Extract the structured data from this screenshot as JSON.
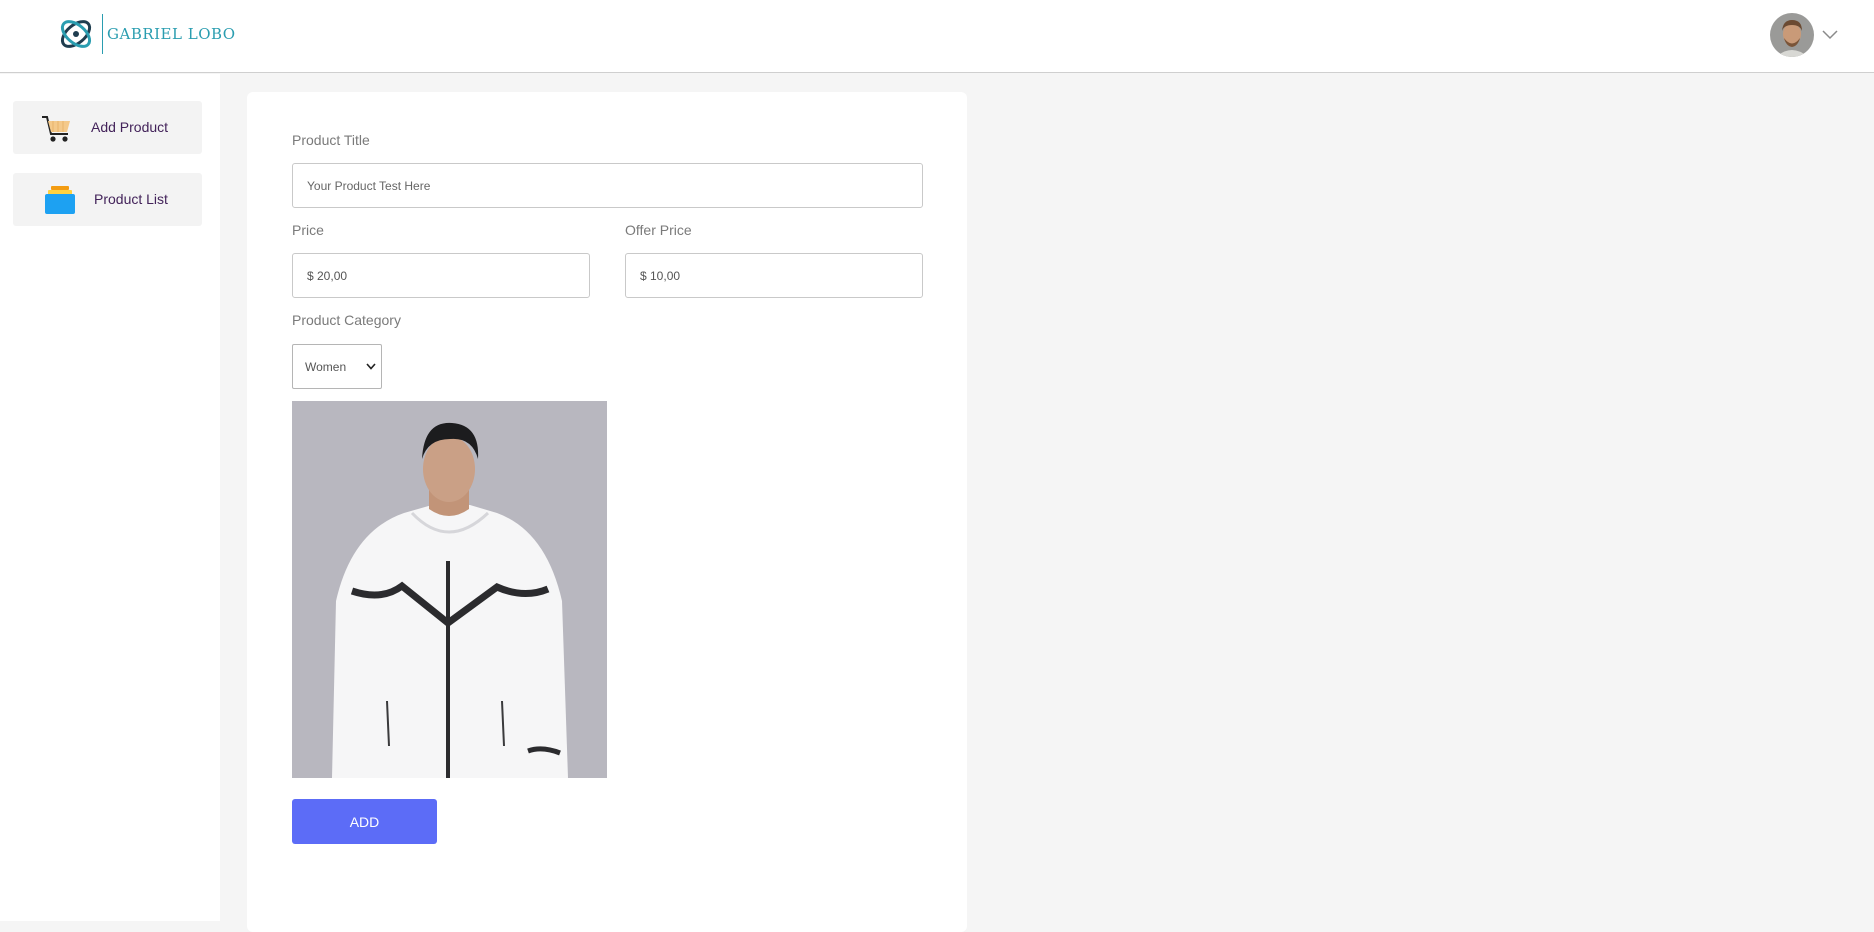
{
  "header": {
    "brand_name": "GABRIEL LOBO",
    "logo_icon": "orbit-logo-icon",
    "brand_color": "#2a9db0",
    "profile_menu_icon": "chevron-down-icon"
  },
  "sidebar": {
    "items": [
      {
        "label": "Add Product",
        "icon": "cart-icon"
      },
      {
        "label": "Product List",
        "icon": "stack-icon"
      }
    ]
  },
  "form": {
    "title_label": "Product Title",
    "title_placeholder": "Your Product Test Here",
    "price_label": "Price",
    "price_value": "$ 20,00",
    "offer_label": "Offer Price",
    "offer_value": "$ 10,00",
    "category_label": "Product Category",
    "category_selected": "Women",
    "upload_image": "upload-image-preview",
    "submit_label": "ADD"
  },
  "colors": {
    "accent": "#5c6cf7",
    "sidebar_text": "#43235a",
    "page_background": "#f5f5f5"
  }
}
